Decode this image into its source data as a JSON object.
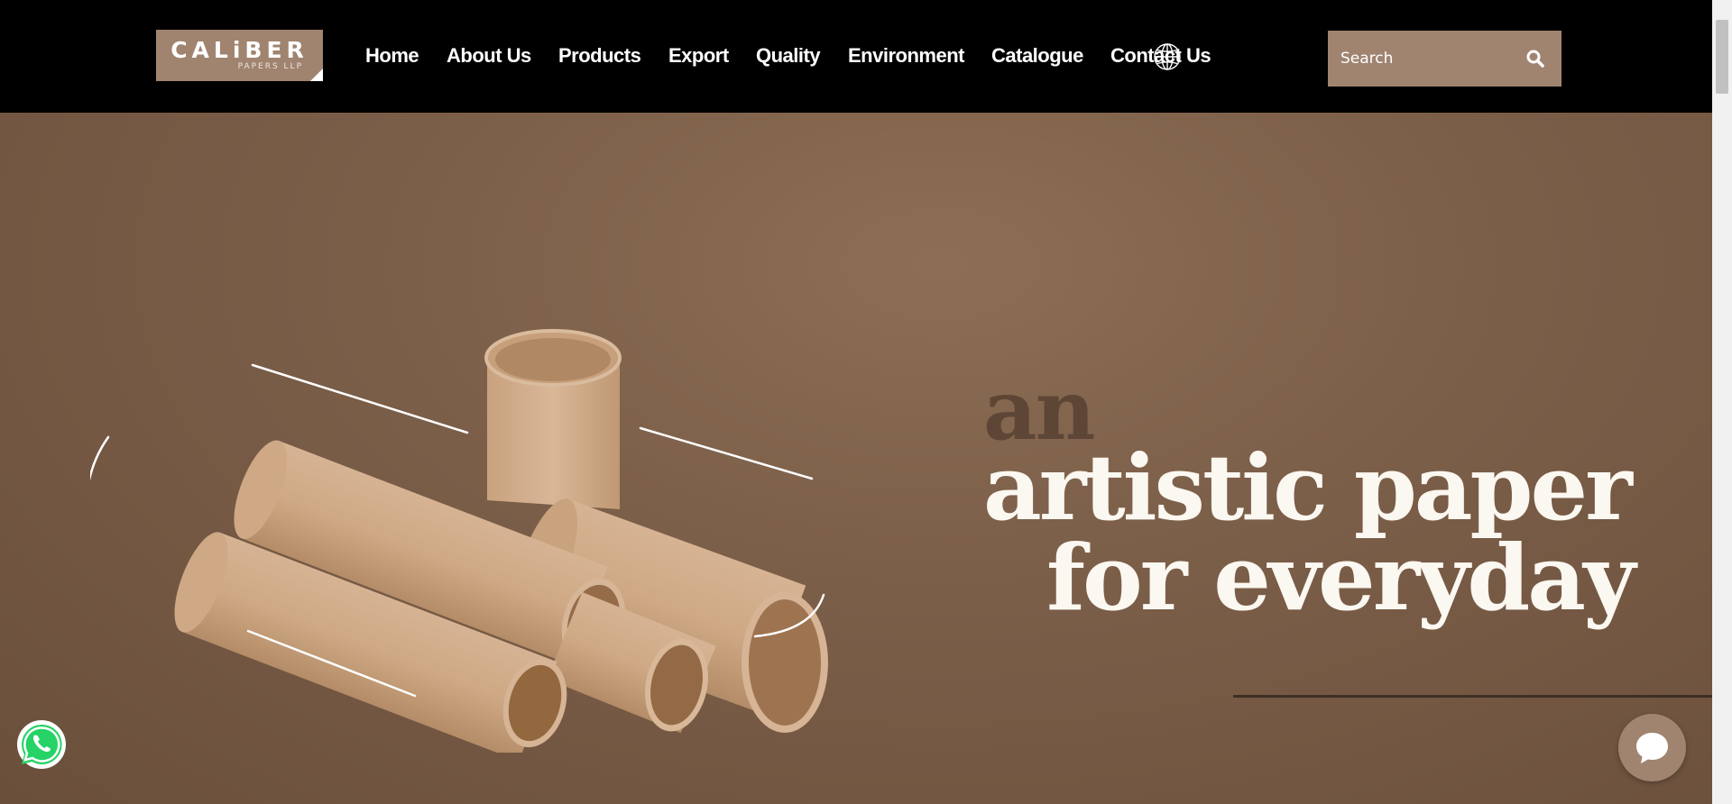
{
  "header": {
    "logo": {
      "name": "CALiBER",
      "subtitle": "PAPERS LLP"
    },
    "nav": [
      {
        "label": "Home",
        "name": "nav-home"
      },
      {
        "label": "About Us",
        "name": "nav-about-us"
      },
      {
        "label": "Products",
        "name": "nav-products"
      },
      {
        "label": "Export",
        "name": "nav-export"
      },
      {
        "label": "Quality",
        "name": "nav-quality"
      },
      {
        "label": "Environment",
        "name": "nav-environment"
      },
      {
        "label": "Catalogue",
        "name": "nav-catalogue"
      },
      {
        "label": "Contact Us",
        "name": "nav-contact-us"
      }
    ],
    "language_icon": "globe-icon",
    "search": {
      "placeholder": "Search",
      "icon": "search-icon"
    }
  },
  "hero": {
    "line1": "an",
    "line2": "artistic paper",
    "line3": "for everyday",
    "image": "paper-tubes"
  },
  "floating": {
    "whatsapp_icon": "whatsapp-icon",
    "chat_icon": "chat-bubble-icon"
  },
  "colors": {
    "header_bg": "#000000",
    "accent": "#a08470",
    "hero_bg": "#7c5f49",
    "headline": "#fbf7f1",
    "headline_muted": "#5e4636"
  }
}
